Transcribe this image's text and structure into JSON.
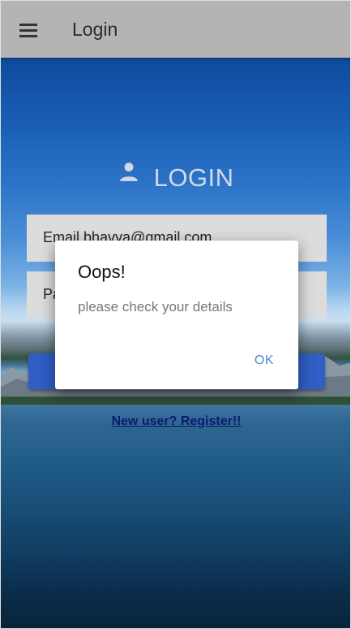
{
  "appbar": {
    "title": "Login",
    "menu_icon": "hamburger-menu-icon"
  },
  "login": {
    "heading": "LOGIN",
    "heading_icon": "person-icon",
    "email_value": "Email  bhavya@gmail.com",
    "password_value": "Pa",
    "register_link": "New user? Register!!"
  },
  "dialog": {
    "title": "Oops!",
    "message": "please check your details",
    "ok_label": "OK"
  },
  "colors": {
    "appbar_bg": "#b4b4b4",
    "button_bg": "#2f5ec4",
    "link": "#0a1a6e",
    "dialog_action": "#4a8ad8"
  }
}
